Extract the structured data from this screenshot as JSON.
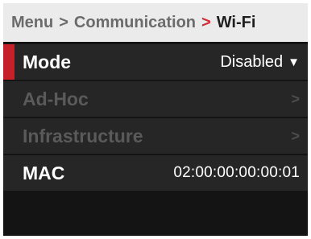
{
  "breadcrumb": {
    "root": "Menu",
    "separator": ">",
    "parent": "Communication",
    "current": "Wi-Fi"
  },
  "rows": [
    {
      "label": "Mode",
      "value": "Disabled",
      "has_dropdown": true,
      "enabled": true,
      "selected": true
    },
    {
      "label": "Ad-Hoc",
      "value": ">",
      "enabled": false
    },
    {
      "label": "Infrastructure",
      "value": ">",
      "enabled": false
    },
    {
      "label": "MAC",
      "value": "02:00:00:00:00:01",
      "enabled": true
    }
  ],
  "icons": {
    "dropdown": "caret-down-icon",
    "submenu": "chevron-right-icon"
  },
  "colors": {
    "accent": "#c6202a",
    "header_bg": "#ebebeb",
    "row_bg": "#262626",
    "screen_bg": "#141414"
  }
}
